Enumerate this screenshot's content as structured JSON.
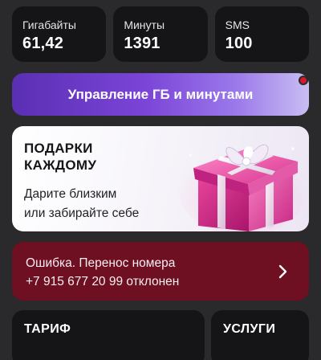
{
  "stats": [
    {
      "label": "Гигабайты",
      "value": "61,42"
    },
    {
      "label": "Минуты",
      "value": "1391"
    },
    {
      "label": "SMS",
      "value": "100"
    }
  ],
  "manage_button": {
    "label": "Управление ГБ и минутами"
  },
  "gift_banner": {
    "title_line1": "ПОДАРКИ",
    "title_line2": "КАЖДОМУ",
    "subtitle_line1": "Дарите близким",
    "subtitle_line2": "или забирайте себе"
  },
  "error_banner": {
    "line1": "Ошибка. Перенос номера",
    "line2": "+7 915 677 20 99 отклонен"
  },
  "cards": {
    "tariff": "ТАРИФ",
    "services": "УСЛУГИ"
  },
  "colors": {
    "background": "#2a2a2c",
    "card": "#151517",
    "error": "#6e0f22",
    "accent_purple": "#7b45d8",
    "notification": "#d3192b"
  }
}
